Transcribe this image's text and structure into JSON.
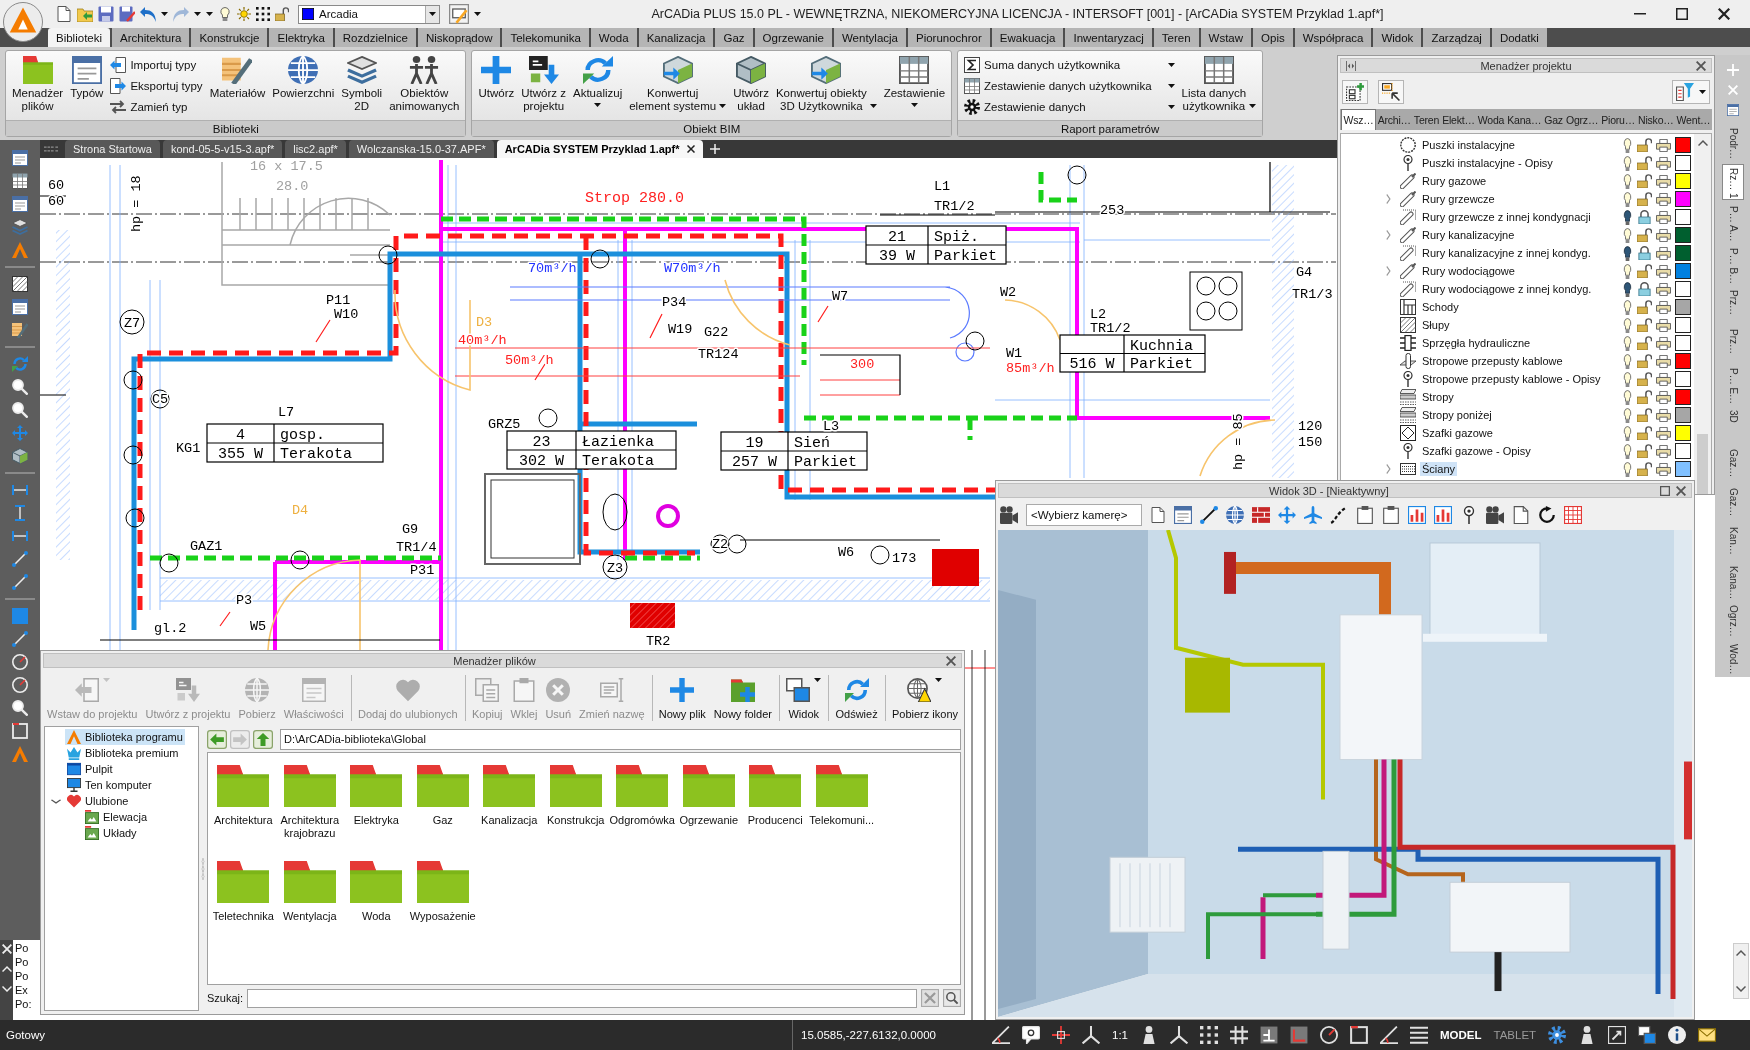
{
  "window": {
    "title": "ArCADia PLUS 15.0 PL - WEWNĘTRZNA, NIEKOMERCYJNA LICENCJA - INTERSOFT [001] - [ArCADia SYSTEM Przyklad 1.apf*]",
    "style_combo": "Arcadia"
  },
  "ribbon_tabs": [
    {
      "label": "Biblioteki",
      "selected": true
    },
    {
      "label": "Architektura",
      "selected": false
    },
    {
      "label": "Konstrukcje",
      "selected": false
    },
    {
      "label": "Elektryka",
      "selected": false
    },
    {
      "label": "Rozdzielnice",
      "selected": false
    },
    {
      "label": "Niskoprądow",
      "selected": false
    },
    {
      "label": "Telekomunika",
      "selected": false
    },
    {
      "label": "Woda",
      "selected": false
    },
    {
      "label": "Kanalizacja",
      "selected": false
    },
    {
      "label": "Gaz",
      "selected": false
    },
    {
      "label": "Ogrzewanie",
      "selected": false
    },
    {
      "label": "Wentylacja",
      "selected": false
    },
    {
      "label": "Piorunochror",
      "selected": false
    },
    {
      "label": "Ewakuacja",
      "selected": false
    },
    {
      "label": "Inwentaryzacj",
      "selected": false
    },
    {
      "label": "Teren",
      "selected": false
    },
    {
      "label": "Wstaw",
      "selected": false
    },
    {
      "label": "Opis",
      "selected": false
    },
    {
      "label": "Współpraca",
      "selected": false
    },
    {
      "label": "Widok",
      "selected": false
    },
    {
      "label": "Zarządzaj",
      "selected": false
    },
    {
      "label": "Dodatki",
      "selected": false
    }
  ],
  "ribbon_groups": [
    {
      "title": "Biblioteki",
      "items": [
        {
          "kind": "large",
          "label": "Menadżer\nplików",
          "dropdown": false
        },
        {
          "kind": "large",
          "label": "Typów",
          "dropdown": false
        },
        {
          "kind": "small",
          "label": "Importuj typy",
          "dropdown": false
        },
        {
          "kind": "small",
          "label": "Eksportuj typy",
          "dropdown": false
        },
        {
          "kind": "small",
          "label": "Zamień typ",
          "dropdown": false
        },
        {
          "kind": "large",
          "label": "Materiałów",
          "dropdown": false
        },
        {
          "kind": "large",
          "label": "Powierzchni",
          "dropdown": false
        },
        {
          "kind": "large",
          "label": "Symboli\n2D",
          "dropdown": false
        },
        {
          "kind": "large",
          "label": "Obiektów\nanimowanych",
          "dropdown": false
        }
      ]
    },
    {
      "title": "Obiekt BIM",
      "items": [
        {
          "kind": "large",
          "label": "Utwórz",
          "dropdown": false
        },
        {
          "kind": "large",
          "label": "Utwórz z\nprojektu",
          "dropdown": false
        },
        {
          "kind": "large",
          "label": "Aktualizuj",
          "dropdown": true
        },
        {
          "kind": "large",
          "label": "Konwertuj\nelement systemu",
          "dropdown": true
        },
        {
          "kind": "large",
          "label": "Utwórz\nukład",
          "dropdown": false
        },
        {
          "kind": "large",
          "label": "Konwertuj obiekty\n3D Użytkownika",
          "dropdown": true
        },
        {
          "kind": "large",
          "label": "Zestawienie",
          "dropdown": true
        }
      ]
    },
    {
      "title": "Raport parametrów",
      "items": [
        {
          "kind": "small",
          "label": "Suma danych użytkownika",
          "dropdown": true
        },
        {
          "kind": "small",
          "label": "Zestawienie danych użytkownika",
          "dropdown": true
        },
        {
          "kind": "small",
          "label": "Zestawienie danych",
          "dropdown": true
        },
        {
          "kind": "large",
          "label": "Lista danych\nużytkownika",
          "dropdown": true
        }
      ]
    }
  ],
  "document_tabs": [
    {
      "label": "Strona Startowa",
      "selected": false
    },
    {
      "label": "kond-05-5-v15-3.apf*",
      "selected": false
    },
    {
      "label": "lisc2.apf*",
      "selected": false
    },
    {
      "label": "Wolczanska-15.0-37.APF*",
      "selected": false
    },
    {
      "label": "ArCADia SYSTEM Przyklad 1.apf*",
      "selected": true
    }
  ],
  "drawing": {
    "labels": [
      {
        "text": "Strop 280.0",
        "kind": "heading"
      },
      {
        "text": "60",
        "kind": "tag"
      },
      {
        "text": "60",
        "kind": "tag"
      },
      {
        "text": "hp = 18",
        "kind": "tag"
      },
      {
        "text": "16 x 17.5",
        "kind": "dim"
      },
      {
        "text": "28.0",
        "kind": "dim"
      },
      {
        "text": "L1",
        "kind": "tag"
      },
      {
        "text": "TR1/2",
        "kind": "tag"
      },
      {
        "text": "253",
        "kind": "tag"
      },
      {
        "text": "W7",
        "kind": "tag"
      },
      {
        "text": "W2",
        "kind": "tag"
      },
      {
        "text": "L2",
        "kind": "tag"
      },
      {
        "text": "TR1/2",
        "kind": "tag"
      },
      {
        "text": "W1",
        "kind": "tag"
      },
      {
        "text": "85m³/h",
        "kind": "flow"
      },
      {
        "text": "G4",
        "kind": "tag"
      },
      {
        "text": "TR1/3",
        "kind": "tag"
      },
      {
        "text": "hp = 85",
        "kind": "tag"
      },
      {
        "text": "120",
        "kind": "tag"
      },
      {
        "text": "150",
        "kind": "tag"
      },
      {
        "text": "P11",
        "kind": "tag"
      },
      {
        "text": "W10",
        "kind": "tag"
      },
      {
        "text": "Z7",
        "kind": "tag"
      },
      {
        "text": "70m³/h",
        "kind": "airflow"
      },
      {
        "text": "W70m³/h",
        "kind": "airflow"
      },
      {
        "text": "P34",
        "kind": "tag"
      },
      {
        "text": "W19",
        "kind": "tag"
      },
      {
        "text": "G22",
        "kind": "tag"
      },
      {
        "text": "TR124",
        "kind": "tag"
      },
      {
        "text": "40m³/h",
        "kind": "flow"
      },
      {
        "text": "50m³/h",
        "kind": "flow"
      },
      {
        "text": "300",
        "kind": "flow"
      },
      {
        "text": "L7",
        "kind": "tag"
      },
      {
        "text": "KG1",
        "kind": "tag"
      },
      {
        "text": "C5",
        "kind": "tag"
      },
      {
        "text": "GRZ5",
        "kind": "tag"
      },
      {
        "text": "L3",
        "kind": "tag"
      },
      {
        "text": "G9",
        "kind": "tag"
      },
      {
        "text": "GAZ1",
        "kind": "tag"
      },
      {
        "text": "TR1/4",
        "kind": "tag"
      },
      {
        "text": "P31",
        "kind": "tag"
      },
      {
        "text": "D4",
        "kind": "door"
      },
      {
        "text": "D3",
        "kind": "door"
      },
      {
        "text": "P3",
        "kind": "tag"
      },
      {
        "text": "gl.2",
        "kind": "tag"
      },
      {
        "text": "W5",
        "kind": "tag"
      },
      {
        "text": "Z3",
        "kind": "tag"
      },
      {
        "text": "Z2",
        "kind": "tag"
      },
      {
        "text": "W6",
        "kind": "tag"
      },
      {
        "text": "173",
        "kind": "tag"
      },
      {
        "text": "TR2",
        "kind": "tag"
      }
    ],
    "rooms": [
      {
        "number": "21",
        "name": "Spiż.",
        "load": "39 W",
        "floor": "Parkiet"
      },
      {
        "name": "Kuchnia",
        "load": "516 W",
        "floor": "Parkiet"
      },
      {
        "number": "4",
        "name": "gosp.",
        "load": "355 W",
        "floor": "Terakota"
      },
      {
        "number": "23",
        "name": "Łazienka",
        "load": "302 W",
        "floor": "Terakota"
      },
      {
        "number": "19",
        "name": "Sień",
        "load": "257 W",
        "floor": "Parkiet"
      }
    ]
  },
  "project_manager": {
    "title": "Menadżer projektu",
    "tabs": [
      {
        "label": "Wsz…",
        "selected": true
      },
      {
        "label": "Archi…",
        "selected": false
      },
      {
        "label": "Teren",
        "selected": false
      },
      {
        "label": "Elekt…",
        "selected": false
      },
      {
        "label": "Woda",
        "selected": false
      },
      {
        "label": "Kana…",
        "selected": false
      },
      {
        "label": "Gaz",
        "selected": false
      },
      {
        "label": "Ogrz…",
        "selected": false
      },
      {
        "label": "Pioru…",
        "selected": false
      },
      {
        "label": "Nisko…",
        "selected": false
      },
      {
        "label": "Went…",
        "selected": false
      }
    ],
    "layers": [
      {
        "name": "Puszki instalacyjne",
        "expandable": false,
        "selected": false,
        "visible": true,
        "locked": false,
        "color": "#ff0000"
      },
      {
        "name": "Puszki instalacyjne - Opisy",
        "expandable": false,
        "selected": false,
        "visible": true,
        "locked": false,
        "color": "#ffffff"
      },
      {
        "name": "Rury gazowe",
        "expandable": false,
        "selected": false,
        "visible": true,
        "locked": false,
        "color": "#ffff00"
      },
      {
        "name": "Rury grzewcze",
        "expandable": true,
        "selected": false,
        "visible": true,
        "locked": false,
        "color": "#ff00ff"
      },
      {
        "name": "Rury grzewcze z innej kondygnacji",
        "expandable": false,
        "selected": false,
        "visible": false,
        "locked": true,
        "color": "#ffffff"
      },
      {
        "name": "Rury kanalizacyjne",
        "expandable": true,
        "selected": false,
        "visible": true,
        "locked": false,
        "color": "#005f2f"
      },
      {
        "name": "Rury kanalizacyjne z innej kondyg.",
        "expandable": false,
        "selected": false,
        "visible": false,
        "locked": true,
        "color": "#005f2f"
      },
      {
        "name": "Rury wodociągowe",
        "expandable": true,
        "selected": false,
        "visible": true,
        "locked": false,
        "color": "#0080e0"
      },
      {
        "name": "Rury wodociągowe z innej kondyg.",
        "expandable": false,
        "selected": false,
        "visible": false,
        "locked": true,
        "color": "#ffffff"
      },
      {
        "name": "Schody",
        "expandable": false,
        "selected": false,
        "visible": true,
        "locked": false,
        "color": "#a6a6a6"
      },
      {
        "name": "Słupy",
        "expandable": false,
        "selected": false,
        "visible": true,
        "locked": false,
        "color": "#ffffff"
      },
      {
        "name": "Sprzęgła hydrauliczne",
        "expandable": false,
        "selected": false,
        "visible": true,
        "locked": false,
        "color": "#ffffff"
      },
      {
        "name": "Stropowe przepusty kablowe",
        "expandable": false,
        "selected": false,
        "visible": true,
        "locked": false,
        "color": "#ff0000"
      },
      {
        "name": "Stropowe przepusty kablowe - Opisy",
        "expandable": false,
        "selected": false,
        "visible": true,
        "locked": false,
        "color": "#ffffff"
      },
      {
        "name": "Stropy",
        "expandable": false,
        "selected": false,
        "visible": true,
        "locked": false,
        "color": "#ff0000"
      },
      {
        "name": "Stropy poniżej",
        "expandable": false,
        "selected": false,
        "visible": true,
        "locked": false,
        "color": "#a6a6a6"
      },
      {
        "name": "Szafki gazowe",
        "expandable": false,
        "selected": false,
        "visible": true,
        "locked": false,
        "color": "#ffff00"
      },
      {
        "name": "Szafki gazowe - Opisy",
        "expandable": false,
        "selected": false,
        "visible": true,
        "locked": false,
        "color": "#ffffff"
      },
      {
        "name": "Ściany",
        "expandable": true,
        "selected": true,
        "visible": true,
        "locked": false,
        "color": "#80c0ff"
      }
    ]
  },
  "dock_tabs": [
    {
      "label": "Podr…",
      "selected": false
    },
    {
      "label": "Rz… 1",
      "selected": true
    },
    {
      "label": "P… A…",
      "selected": false
    },
    {
      "label": "P… B…",
      "selected": false
    },
    {
      "label": "Prz…",
      "selected": false
    },
    {
      "label": "Prz…",
      "selected": false
    },
    {
      "label": "P… E…",
      "selected": false
    },
    {
      "label": "3D",
      "selected": false
    },
    {
      "label": "Gaz…",
      "selected": false
    },
    {
      "label": "Gaz…",
      "selected": false
    },
    {
      "label": "Kan…",
      "selected": false
    },
    {
      "label": "Kana…",
      "selected": false
    },
    {
      "label": "Ogrz…",
      "selected": false
    },
    {
      "label": "Wod…",
      "selected": false
    }
  ],
  "view_3d": {
    "title": "Widok 3D - [Nieaktywny]",
    "camera": "<Wybierz kamerę>"
  },
  "file_manager": {
    "title": "Menadżer plików",
    "toolbar": [
      {
        "label": "Wstaw do projektu",
        "disabled": true,
        "dropdown": true
      },
      {
        "label": "Utwórz z projektu",
        "disabled": true,
        "dropdown": false
      },
      {
        "label": "Pobierz",
        "disabled": true,
        "dropdown": false
      },
      {
        "label": "Właściwości",
        "disabled": true,
        "dropdown": false
      },
      {
        "label": "Dodaj do ulubionych",
        "disabled": true,
        "dropdown": false
      },
      {
        "label": "Kopiuj",
        "disabled": true,
        "dropdown": false
      },
      {
        "label": "Wklej",
        "disabled": true,
        "dropdown": false
      },
      {
        "label": "Usuń",
        "disabled": true,
        "dropdown": false
      },
      {
        "label": "Zmień nazwę",
        "disabled": true,
        "dropdown": false
      },
      {
        "label": "Nowy plik",
        "disabled": false,
        "dropdown": false
      },
      {
        "label": "Nowy folder",
        "disabled": false,
        "dropdown": false
      },
      {
        "label": "Widok",
        "disabled": false,
        "dropdown": true
      },
      {
        "label": "Odśwież",
        "disabled": false,
        "dropdown": false
      },
      {
        "label": "Pobierz ikony",
        "disabled": false,
        "dropdown": true
      }
    ],
    "tree": [
      {
        "label": "Biblioteka programu",
        "selected": true
      },
      {
        "label": "Biblioteka premium",
        "selected": false
      },
      {
        "label": "Pulpit",
        "selected": false
      },
      {
        "label": "Ten komputer",
        "selected": false
      },
      {
        "label": "Ulubione",
        "selected": false,
        "expanded": true,
        "children": [
          {
            "label": "Elewacja",
            "selected": false
          },
          {
            "label": "Układy",
            "selected": false
          }
        ]
      }
    ],
    "path": "D:\\ArCADia-biblioteka\\Global",
    "folders": [
      {
        "label": "Architektura"
      },
      {
        "label": "Architektura krajobrazu"
      },
      {
        "label": "Elektryka"
      },
      {
        "label": "Gaz"
      },
      {
        "label": "Kanalizacja"
      },
      {
        "label": "Konstrukcja"
      },
      {
        "label": "Odgromówka"
      },
      {
        "label": "Ogrzewanie"
      },
      {
        "label": "Producenci"
      },
      {
        "label": "Telekomuni..."
      },
      {
        "label": "Teletechnika"
      },
      {
        "label": "Wentylacja"
      },
      {
        "label": "Woda"
      },
      {
        "label": "Wyposażenie"
      }
    ],
    "search_label": "Szukaj:"
  },
  "command_history": [
    "Po",
    "Po",
    "Po",
    "Ex",
    "Po:"
  ],
  "status_bar": {
    "text": "Gotowy",
    "coordinates": "15.0585,-227.6132,0.0000",
    "scale": "1:1",
    "modes": [
      {
        "label": "MODEL",
        "selected": true
      },
      {
        "label": "TABLET",
        "selected": false
      }
    ]
  }
}
